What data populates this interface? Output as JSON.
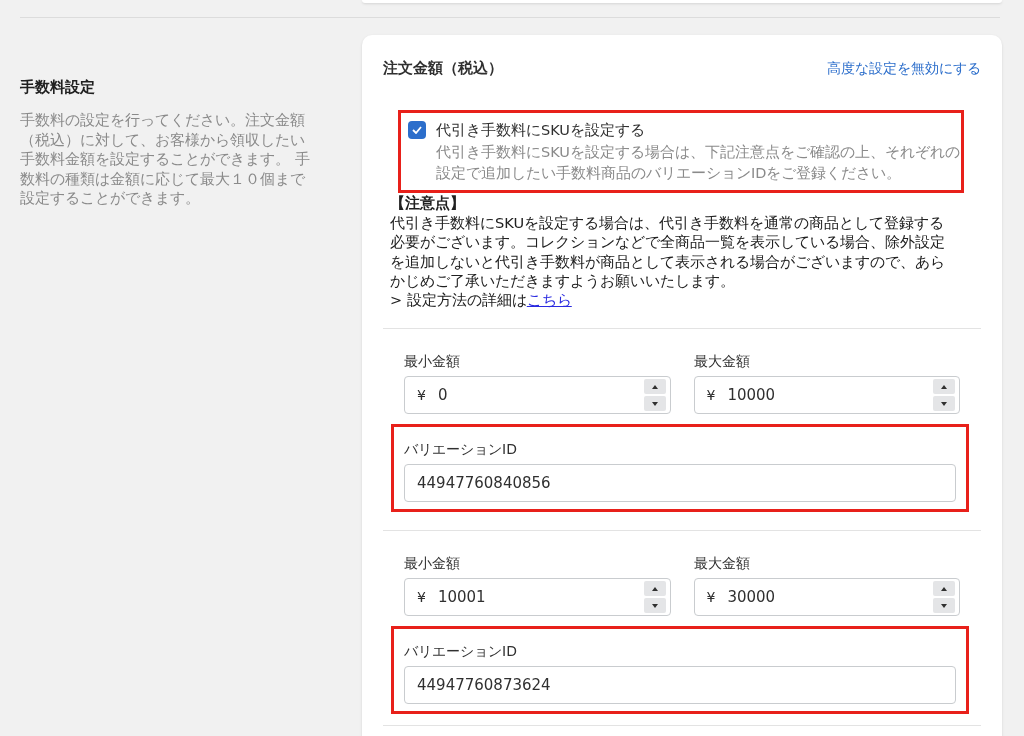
{
  "section": {
    "title": "手数料設定",
    "description": "手数料の設定を行ってください。注文金額（税込）に対して、お客様から領収したい手数料金額を設定することができます。 手数料の種類は金額に応じて最大１０個まで設定することができます。"
  },
  "card": {
    "title": "注文金額（税込）",
    "link": "高度な設定を無効にする",
    "sku_option": {
      "label": "代引き手数料にSKUを設定する",
      "checked": true,
      "highlighted": true,
      "help": "代引き手数料にSKUを設定する場合は、下記注意点をご確認の上、それぞれの設定で追加したい手数料商品のバリエーションIDをご登録ください。"
    },
    "notice": {
      "heading": "【注意点】",
      "body": "代引き手数料にSKUを設定する場合は、代引き手数料を通常の商品として登録する必要がございます。コレクションなどで全商品一覧を表示している場合、除外設定を追加しないと代引き手数料が商品として表示される場合がございますので、あらかじめご了承いただきますようお願いいたします。",
      "details_prefix": "> 設定方法の詳細は",
      "details_link": "こちら"
    }
  },
  "tiers": [
    {
      "min": {
        "label": "最小金額",
        "currency": "¥",
        "value": "0"
      },
      "max": {
        "label": "最大金額",
        "currency": "¥",
        "value": "10000"
      },
      "variation": {
        "label": "バリエーションID",
        "value": "44947760840856",
        "highlighted": true
      }
    },
    {
      "min": {
        "label": "最小金額",
        "currency": "¥",
        "value": "10001"
      },
      "max": {
        "label": "最大金額",
        "currency": "¥",
        "value": "30000"
      },
      "variation": {
        "label": "バリエーションID",
        "value": "44947760873624",
        "highlighted": true
      }
    }
  ]
}
